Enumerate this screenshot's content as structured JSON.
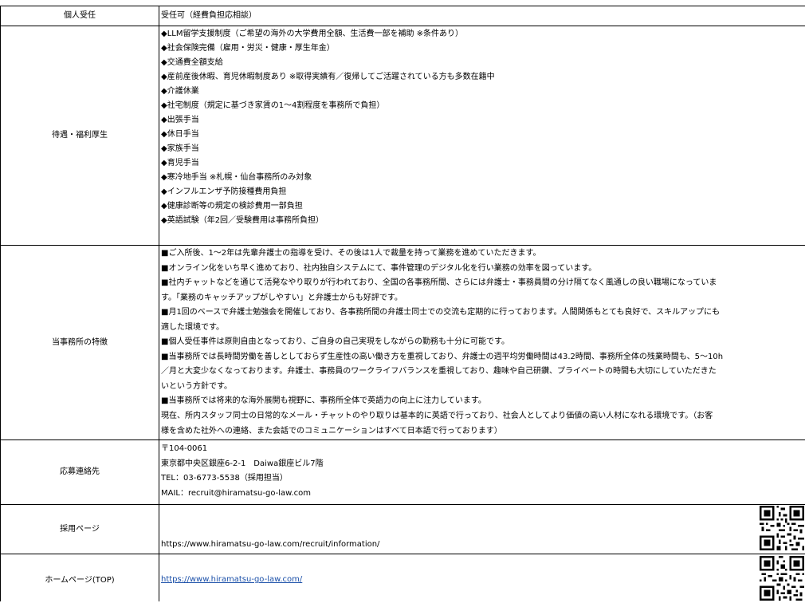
{
  "rows": {
    "individual": {
      "label": "個人受任",
      "value": "受任可（経費負担応相談）"
    },
    "benefits": {
      "label": "待遇・福利厚生",
      "items": [
        "◆LLM留学支援制度（ご希望の海外の大学費用全額、生活費一部を補助 ※条件あり）",
        "◆社会保険完備（雇用・労災・健康・厚生年金）",
        "◆交通費全額支給",
        "◆産前産後休暇、育児休暇制度あり ※取得実績有／復帰してご活躍されている方も多数在籍中",
        "◆介護休業",
        "◆社宅制度（規定に基づき家賃の1～4割程度を事務所で負担）",
        "◆出張手当",
        "◆休日手当",
        "◆家族手当",
        "◆育児手当",
        "◆寒冷地手当 ※札幌・仙台事務所のみ対象",
        "◆インフルエンザ予防接種費用負担",
        "◆健康診断等の規定の検診費用一部負担",
        "◆英語試験（年2回／受験費用は事務所負担）"
      ]
    },
    "features": {
      "label": "当事務所の特徴",
      "lines": [
        "■ご入所後、1～2年は先輩弁護士の指導を受け、その後は1人で裁量を持って業務を進めていただきます。",
        "■オンライン化をいち早く進めており、社内独自システムにて、事件管理のデジタル化を行い業務の効率を図っています。",
        "■社内チャットなどを通じて活発なやり取りが行われており、全国の各事務所間、さらには弁護士・事務員間の分け隔てなく風通しの良い職場になっていま",
        "す。「業務のキャッチアップがしやすい」と弁護士からも好評です。",
        "■月1回のベースで弁護士勉強会を開催しており、各事務所間の弁護士同士での交流も定期的に行っております。人間関係もとても良好で、スキルアップにも",
        "適した環境です。",
        "■個人受任事件は原則自由となっており、ご自身の自己実現をしながらの勤務も十分に可能です。",
        "■当事務所では長時間労働を善しとしておらず生産性の高い働き方を重視しており、弁護士の週平均労働時間は43.2時間、事務所全体の残業時間も、5～10h",
        "／月と大変少なくなっております。弁護士、事務員のワークライフバランスを重視しており、趣味や自己研鑽、プライベートの時間も大切にしていただきた",
        "いという方針です。",
        "■当事務所では将来的な海外展開も視野に、事務所全体で英語力の向上に注力しています。",
        "現在、所内スタッフ同士の日常的なメール・チャットのやり取りは基本的に英語で行っており、社会人としてより価値の高い人材になれる環境です。（お客",
        "様を含めた社外への連絡、また会話でのコミュニケーションはすべて日本語で行っております）"
      ]
    },
    "contact": {
      "label": "応募連絡先",
      "postal": "〒104-0061",
      "address": "東京都中央区銀座6-2-1　Daiwa銀座ビル7階",
      "tel": "TEL：03-6773-5538（採用担当）",
      "mail": "MAIL：recruit@hiramatsu-go-law.com"
    },
    "recruit_page": {
      "label": "採用ページ",
      "url": "https://www.hiramatsu-go-law.com/recruit/information/"
    },
    "homepage": {
      "label": "ホームページ(TOP)",
      "url": "https://www.hiramatsu-go-law.com/"
    }
  },
  "icons": {
    "qr": "qr-code-icon"
  }
}
